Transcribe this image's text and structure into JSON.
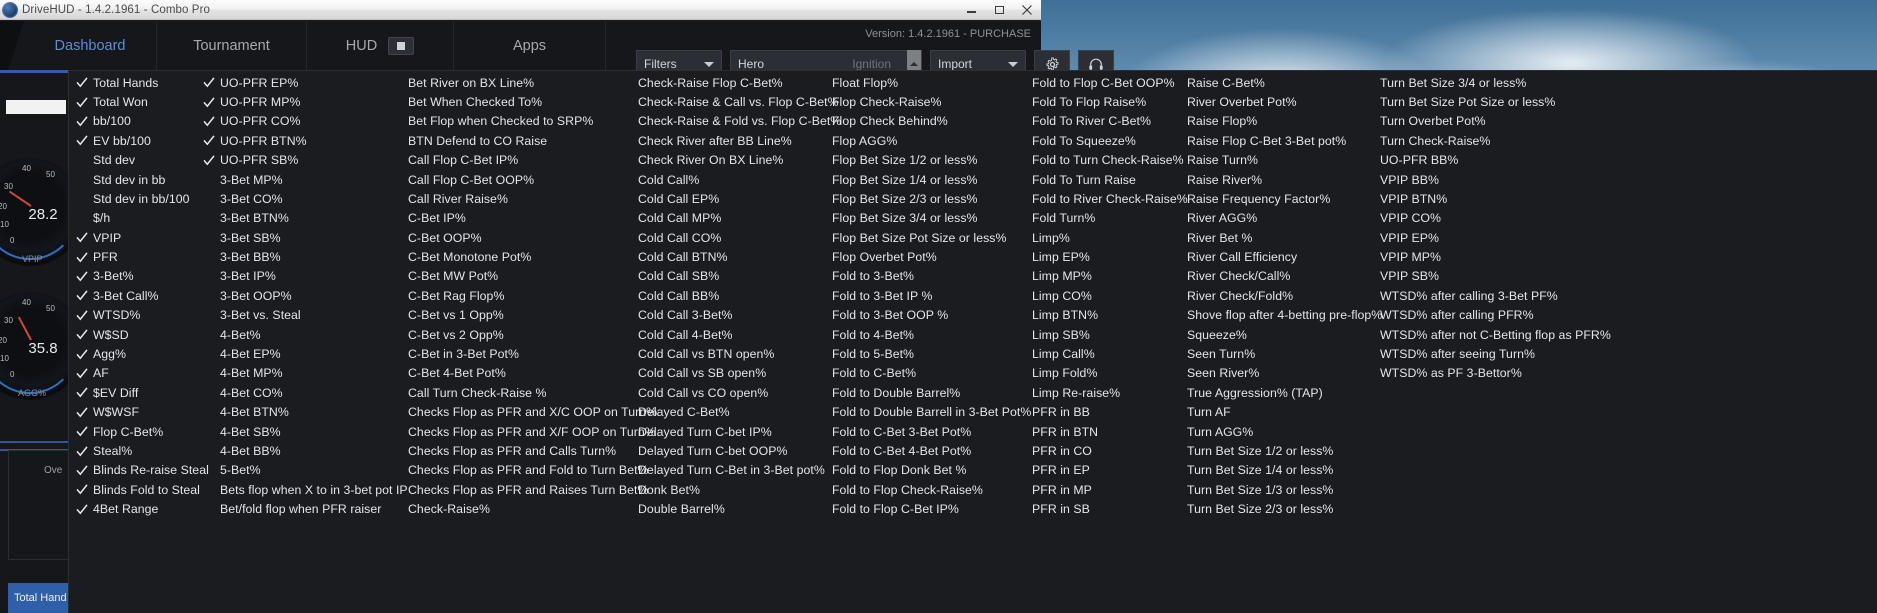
{
  "window": {
    "title": "DriveHUD - 1.4.2.1961 - Combo Pro",
    "minimize_label": "minimize",
    "maximize_label": "maximize",
    "close_label": "close"
  },
  "nav": {
    "items": [
      {
        "label": "Dashboard",
        "active": true
      },
      {
        "label": "Tournament",
        "active": false
      },
      {
        "label": "HUD",
        "active": false
      },
      {
        "label": "Apps",
        "active": false
      }
    ],
    "version": "Version: 1.4.2.1961 - PURCHASE"
  },
  "toolbar": {
    "filters_label": "Filters",
    "hero_label": "Hero",
    "hero_value": "Ignition",
    "import_label": "Import",
    "settings_icon": "gear-icon",
    "support_icon": "headset-icon"
  },
  "dashboard": {
    "gauge1_value": "28.2",
    "gauge1_name": "VPIP",
    "gauge1_ticks": [
      "10",
      "20",
      "30",
      "40",
      "50",
      "0"
    ],
    "gauge2_value": "35.8",
    "gauge2_name": "AGG%",
    "gauge2_ticks": [
      "10",
      "20",
      "30",
      "40",
      "50",
      "0"
    ],
    "over_label": "Ove",
    "bottom_button": "Total Hand"
  },
  "accent_colors": {
    "nav_active": "#5b8dd9",
    "menu_bg": "#1a1c20",
    "menu_text": "#e4e6e9",
    "checkmark": "#e9ebee",
    "titlebar_text": "#4b4b4b",
    "gauge_ring": "#2e6fc4",
    "needle": "#d3443c"
  },
  "stat_menu": {
    "columns": [
      {
        "name": "column-1",
        "items": [
          {
            "label": "Total Hands",
            "checked": true
          },
          {
            "label": "Total Won",
            "checked": true
          },
          {
            "label": "bb/100",
            "checked": true
          },
          {
            "label": "EV bb/100",
            "checked": true
          },
          {
            "label": "Std dev",
            "checked": false
          },
          {
            "label": "Std dev in bb",
            "checked": false
          },
          {
            "label": "Std dev in bb/100",
            "checked": false
          },
          {
            "label": "$/h",
            "checked": false
          },
          {
            "label": "VPIP",
            "checked": true
          },
          {
            "label": "PFR",
            "checked": true
          },
          {
            "label": "3-Bet%",
            "checked": true
          },
          {
            "label": "3-Bet Call%",
            "checked": true
          },
          {
            "label": "WTSD%",
            "checked": true
          },
          {
            "label": "W$SD",
            "checked": true
          },
          {
            "label": "Agg%",
            "checked": true
          },
          {
            "label": "AF",
            "checked": true
          },
          {
            "label": "$EV Diff",
            "checked": true
          },
          {
            "label": "W$WSF",
            "checked": true
          },
          {
            "label": "Flop C-Bet%",
            "checked": true
          },
          {
            "label": "Steal%",
            "checked": true
          },
          {
            "label": "Blinds Re-raise Steal",
            "checked": true
          },
          {
            "label": "Blinds Fold to Steal",
            "checked": true
          },
          {
            "label": "4Bet Range",
            "checked": true
          }
        ]
      },
      {
        "name": "column-2",
        "items": [
          {
            "label": "UO-PFR EP%",
            "checked": true
          },
          {
            "label": "UO-PFR MP%",
            "checked": true
          },
          {
            "label": "UO-PFR CO%",
            "checked": true
          },
          {
            "label": "UO-PFR BTN%",
            "checked": true
          },
          {
            "label": "UO-PFR SB%",
            "checked": true
          },
          {
            "label": "3-Bet MP%",
            "checked": false
          },
          {
            "label": "3-Bet CO%",
            "checked": false
          },
          {
            "label": "3-Bet BTN%",
            "checked": false
          },
          {
            "label": "3-Bet SB%",
            "checked": false
          },
          {
            "label": "3-Bet BB%",
            "checked": false
          },
          {
            "label": "3-Bet IP%",
            "checked": false
          },
          {
            "label": "3-Bet OOP%",
            "checked": false
          },
          {
            "label": "3-Bet vs. Steal",
            "checked": false
          },
          {
            "label": "4-Bet%",
            "checked": false
          },
          {
            "label": "4-Bet EP%",
            "checked": false
          },
          {
            "label": "4-Bet MP%",
            "checked": false
          },
          {
            "label": "4-Bet CO%",
            "checked": false
          },
          {
            "label": "4-Bet BTN%",
            "checked": false
          },
          {
            "label": "4-Bet SB%",
            "checked": false
          },
          {
            "label": "4-Bet BB%",
            "checked": false
          },
          {
            "label": "5-Bet%",
            "checked": false
          },
          {
            "label": "Bets flop when X to in 3-bet pot IP",
            "checked": false
          },
          {
            "label": "Bet/fold flop when PFR raiser",
            "checked": false
          }
        ]
      },
      {
        "name": "column-3",
        "items": [
          {
            "label": "Bet River on BX Line%",
            "checked": false
          },
          {
            "label": "Bet When Checked To%",
            "checked": false
          },
          {
            "label": "Bet Flop when Checked to SRP%",
            "checked": false
          },
          {
            "label": "BTN Defend to CO Raise",
            "checked": false
          },
          {
            "label": "Call Flop C-Bet IP%",
            "checked": false
          },
          {
            "label": "Call Flop C-Bet OOP%",
            "checked": false
          },
          {
            "label": "Call River Raise%",
            "checked": false
          },
          {
            "label": "C-Bet IP%",
            "checked": false
          },
          {
            "label": "C-Bet OOP%",
            "checked": false
          },
          {
            "label": "C-Bet Monotone Pot%",
            "checked": false
          },
          {
            "label": "C-Bet MW Pot%",
            "checked": false
          },
          {
            "label": "C-Bet Rag Flop%",
            "checked": false
          },
          {
            "label": "C-Bet vs 1 Opp%",
            "checked": false
          },
          {
            "label": "C-Bet vs 2 Opp%",
            "checked": false
          },
          {
            "label": "C-Bet in 3-Bet Pot%",
            "checked": false
          },
          {
            "label": "C-Bet 4-Bet Pot%",
            "checked": false
          },
          {
            "label": "Call Turn Check-Raise %",
            "checked": false
          },
          {
            "label": "Checks Flop as PFR and X/C OOP on Turn%",
            "checked": false
          },
          {
            "label": "Checks Flop as PFR and X/F OOP on Turn%",
            "checked": false
          },
          {
            "label": "Checks Flop as PFR and Calls Turn%",
            "checked": false
          },
          {
            "label": "Checks Flop as PFR and Fold to Turn Bet%",
            "checked": false
          },
          {
            "label": "Checks Flop as PFR and Raises Turn Bet%",
            "checked": false
          },
          {
            "label": "Check-Raise%",
            "checked": false
          }
        ]
      },
      {
        "name": "column-4",
        "items": [
          {
            "label": "Check-Raise Flop C-Bet%",
            "checked": false
          },
          {
            "label": "Check-Raise & Call vs. Flop C-Bet%",
            "checked": false
          },
          {
            "label": "Check-Raise & Fold vs. Flop C-Bet%",
            "checked": false
          },
          {
            "label": "Check River after BB Line%",
            "checked": false
          },
          {
            "label": "Check River On BX Line%",
            "checked": false
          },
          {
            "label": "Cold Call%",
            "checked": false
          },
          {
            "label": "Cold Call EP%",
            "checked": false
          },
          {
            "label": "Cold Call MP%",
            "checked": false
          },
          {
            "label": "Cold Call CO%",
            "checked": false
          },
          {
            "label": "Cold Call BTN%",
            "checked": false
          },
          {
            "label": "Cold Call SB%",
            "checked": false
          },
          {
            "label": "Cold Call BB%",
            "checked": false
          },
          {
            "label": "Cold Call 3-Bet%",
            "checked": false
          },
          {
            "label": "Cold Call 4-Bet%",
            "checked": false
          },
          {
            "label": "Cold Call vs BTN open%",
            "checked": false
          },
          {
            "label": "Cold Call vs SB open%",
            "checked": false
          },
          {
            "label": "Cold Call vs CO open%",
            "checked": false
          },
          {
            "label": "Delayed C-Bet%",
            "checked": false
          },
          {
            "label": "Delayed Turn C-bet IP%",
            "checked": false
          },
          {
            "label": "Delayed Turn C-bet OOP%",
            "checked": false
          },
          {
            "label": "Delayed Turn C-Bet in 3-Bet pot%",
            "checked": false
          },
          {
            "label": "Donk Bet%",
            "checked": false
          },
          {
            "label": "Double Barrel%",
            "checked": false
          }
        ]
      },
      {
        "name": "column-5",
        "items": [
          {
            "label": "Float Flop%",
            "checked": false
          },
          {
            "label": "Flop Check-Raise%",
            "checked": false
          },
          {
            "label": "Flop Check Behind%",
            "checked": false
          },
          {
            "label": "Flop AGG%",
            "checked": false
          },
          {
            "label": "Flop Bet Size 1/2 or less%",
            "checked": false
          },
          {
            "label": "Flop Bet Size 1/4 or less%",
            "checked": false
          },
          {
            "label": "Flop Bet Size 2/3 or less%",
            "checked": false
          },
          {
            "label": "Flop Bet Size 3/4 or less%",
            "checked": false
          },
          {
            "label": "Flop Bet Size Pot Size or less%",
            "checked": false
          },
          {
            "label": "Flop Overbet Pot%",
            "checked": false
          },
          {
            "label": "Fold to 3-Bet%",
            "checked": false
          },
          {
            "label": "Fold to 3-Bet IP %",
            "checked": false
          },
          {
            "label": "Fold to 3-Bet OOP %",
            "checked": false
          },
          {
            "label": "Fold to 4-Bet%",
            "checked": false
          },
          {
            "label": "Fold to 5-Bet%",
            "checked": false
          },
          {
            "label": "Fold to C-Bet%",
            "checked": false
          },
          {
            "label": "Fold to Double Barrel%",
            "checked": false
          },
          {
            "label": "Fold to Double Barrell in 3-Bet Pot%",
            "checked": false
          },
          {
            "label": "Fold to C-Bet 3-Bet Pot%",
            "checked": false
          },
          {
            "label": "Fold to C-Bet 4-Bet Pot%",
            "checked": false
          },
          {
            "label": "Fold to Flop Donk Bet %",
            "checked": false
          },
          {
            "label": "Fold to Flop Check-Raise%",
            "checked": false
          },
          {
            "label": "Fold to Flop C-Bet IP%",
            "checked": false
          }
        ]
      },
      {
        "name": "column-6",
        "items": [
          {
            "label": "Fold to Flop C-Bet OOP%",
            "checked": false
          },
          {
            "label": "Fold To Flop Raise%",
            "checked": false
          },
          {
            "label": "Fold To River C-Bet%",
            "checked": false
          },
          {
            "label": "Fold To Squeeze%",
            "checked": false
          },
          {
            "label": "Fold to Turn Check-Raise%",
            "checked": false
          },
          {
            "label": "Fold To Turn Raise",
            "checked": false
          },
          {
            "label": "Fold to River Check-Raise%",
            "checked": false
          },
          {
            "label": "Fold Turn%",
            "checked": false
          },
          {
            "label": "Limp%",
            "checked": false
          },
          {
            "label": "Limp EP%",
            "checked": false
          },
          {
            "label": "Limp MP%",
            "checked": false
          },
          {
            "label": "Limp CO%",
            "checked": false
          },
          {
            "label": "Limp BTN%",
            "checked": false
          },
          {
            "label": "Limp SB%",
            "checked": false
          },
          {
            "label": "Limp Call%",
            "checked": false
          },
          {
            "label": "Limp Fold%",
            "checked": false
          },
          {
            "label": "Limp Re-raise%",
            "checked": false
          },
          {
            "label": "PFR in BB",
            "checked": false
          },
          {
            "label": "PFR in BTN",
            "checked": false
          },
          {
            "label": "PFR in CO",
            "checked": false
          },
          {
            "label": "PFR in EP",
            "checked": false
          },
          {
            "label": "PFR in MP",
            "checked": false
          },
          {
            "label": "PFR in SB",
            "checked": false
          }
        ]
      },
      {
        "name": "column-7",
        "items": [
          {
            "label": "Raise C-Bet%",
            "checked": false
          },
          {
            "label": "River Overbet Pot%",
            "checked": false
          },
          {
            "label": "Raise Flop%",
            "checked": false
          },
          {
            "label": "Raise Flop C-Bet 3-Bet pot%",
            "checked": false
          },
          {
            "label": "Raise Turn%",
            "checked": false
          },
          {
            "label": "Raise River%",
            "checked": false
          },
          {
            "label": "Raise Frequency Factor%",
            "checked": false
          },
          {
            "label": "River AGG%",
            "checked": false
          },
          {
            "label": "River Bet %",
            "checked": false
          },
          {
            "label": "River Call Efficiency",
            "checked": false
          },
          {
            "label": "River Check/Call%",
            "checked": false
          },
          {
            "label": "River Check/Fold%",
            "checked": false
          },
          {
            "label": "Shove flop after 4-betting pre-flop%",
            "checked": false
          },
          {
            "label": "Squeeze%",
            "checked": false
          },
          {
            "label": "Seen Turn%",
            "checked": false
          },
          {
            "label": "Seen River%",
            "checked": false
          },
          {
            "label": "True Aggression% (TAP)",
            "checked": false
          },
          {
            "label": "Turn AF",
            "checked": false
          },
          {
            "label": "Turn AGG%",
            "checked": false
          },
          {
            "label": "Turn Bet Size 1/2 or less%",
            "checked": false
          },
          {
            "label": "Turn Bet Size 1/4 or less%",
            "checked": false
          },
          {
            "label": "Turn Bet Size 1/3 or less%",
            "checked": false
          },
          {
            "label": "Turn Bet Size 2/3 or less%",
            "checked": false
          }
        ]
      },
      {
        "name": "column-8",
        "items": [
          {
            "label": "Turn Bet Size 3/4 or less%",
            "checked": false
          },
          {
            "label": "Turn Bet Size Pot Size or less%",
            "checked": false
          },
          {
            "label": "Turn Overbet Pot%",
            "checked": false
          },
          {
            "label": "Turn Check-Raise%",
            "checked": false
          },
          {
            "label": "UO-PFR BB%",
            "checked": false
          },
          {
            "label": "VPIP BB%",
            "checked": false
          },
          {
            "label": "VPIP BTN%",
            "checked": false
          },
          {
            "label": "VPIP CO%",
            "checked": false
          },
          {
            "label": "VPIP EP%",
            "checked": false
          },
          {
            "label": "VPIP MP%",
            "checked": false
          },
          {
            "label": "VPIP SB%",
            "checked": false
          },
          {
            "label": "WTSD% after calling 3-Bet PF%",
            "checked": false
          },
          {
            "label": "WTSD% after calling PFR%",
            "checked": false
          },
          {
            "label": "WTSD% after not C-Betting flop as PFR%",
            "checked": false
          },
          {
            "label": "WTSD% after seeing Turn%",
            "checked": false
          },
          {
            "label": "WTSD% as PF 3-Bettor%",
            "checked": false
          }
        ]
      }
    ]
  }
}
